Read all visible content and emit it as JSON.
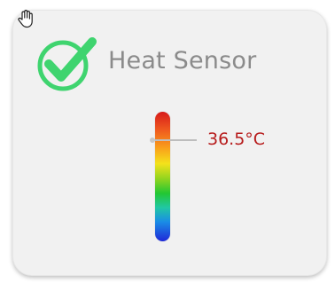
{
  "widget": {
    "title": "Heat Sensor",
    "temperature": "36.5°C",
    "status": "ok",
    "status_icon": "check-circle-icon",
    "cursor_icon": "hand-pointer-icon"
  },
  "colors": {
    "card_background": "#f1f1f1",
    "title_text": "#8b8b8b",
    "check_green": "#3fd46f",
    "temperature_text": "#b71c1c",
    "gradient_top": "#d71a1a",
    "gradient_bottom": "#1f29d8"
  }
}
